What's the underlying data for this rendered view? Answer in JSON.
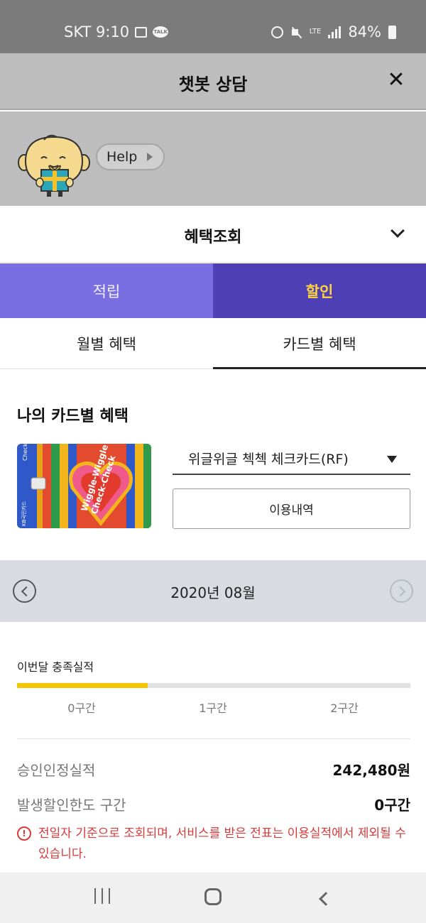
{
  "status_bar": {
    "carrier_time": "SKT 9:10",
    "talk_badge": "TALK",
    "network": "LTE",
    "battery": "84%"
  },
  "header": {
    "title": "챗봇 상담",
    "close_label": "✕"
  },
  "mascot": {
    "help_label": "Help"
  },
  "benefit_dropdown": {
    "title": "혜택조회"
  },
  "benefit_type_tabs": {
    "accumulate": "적립",
    "discount": "할인",
    "selected": "discount"
  },
  "view_tabs": {
    "monthly": "월별 혜택",
    "by_card": "카드별 혜택",
    "selected": "by_card"
  },
  "card_section": {
    "title": "나의 카드별 혜택",
    "card_name": "위글위글 첵첵 체크카드(RF)",
    "usage_button": "이용내역",
    "card_text": {
      "side_top": "Check",
      "side_bottom": "KB국민카드",
      "heart_line1": "Wiggle-Wiggle",
      "heart_line2": "Check-Check"
    }
  },
  "month_selector": {
    "month": "2020년 08월"
  },
  "performance": {
    "label": "이번달 충족실적",
    "progress": 0.333,
    "tiers": [
      "0구간",
      "1구간",
      "2구간"
    ]
  },
  "summary": {
    "approved_label": "승인인정실적",
    "approved_value": "242,480원",
    "tier_label": "발생할인한도 구간",
    "tier_value": "0구간"
  },
  "notice": {
    "icon": "!",
    "text": "전일자 기준으로 조회되며, 서비스를 받은 전표는 이용실적에서 제외될 수 있습니다."
  },
  "colors": {
    "header_gray": "#bdbdbd",
    "tab_light_purple": "#7a6ee3",
    "tab_dark_purple": "#4f3fb4",
    "tab_selected_text": "#ffd23f",
    "progress_fill": "#f5c400",
    "notice_red": "#d93a3a"
  }
}
